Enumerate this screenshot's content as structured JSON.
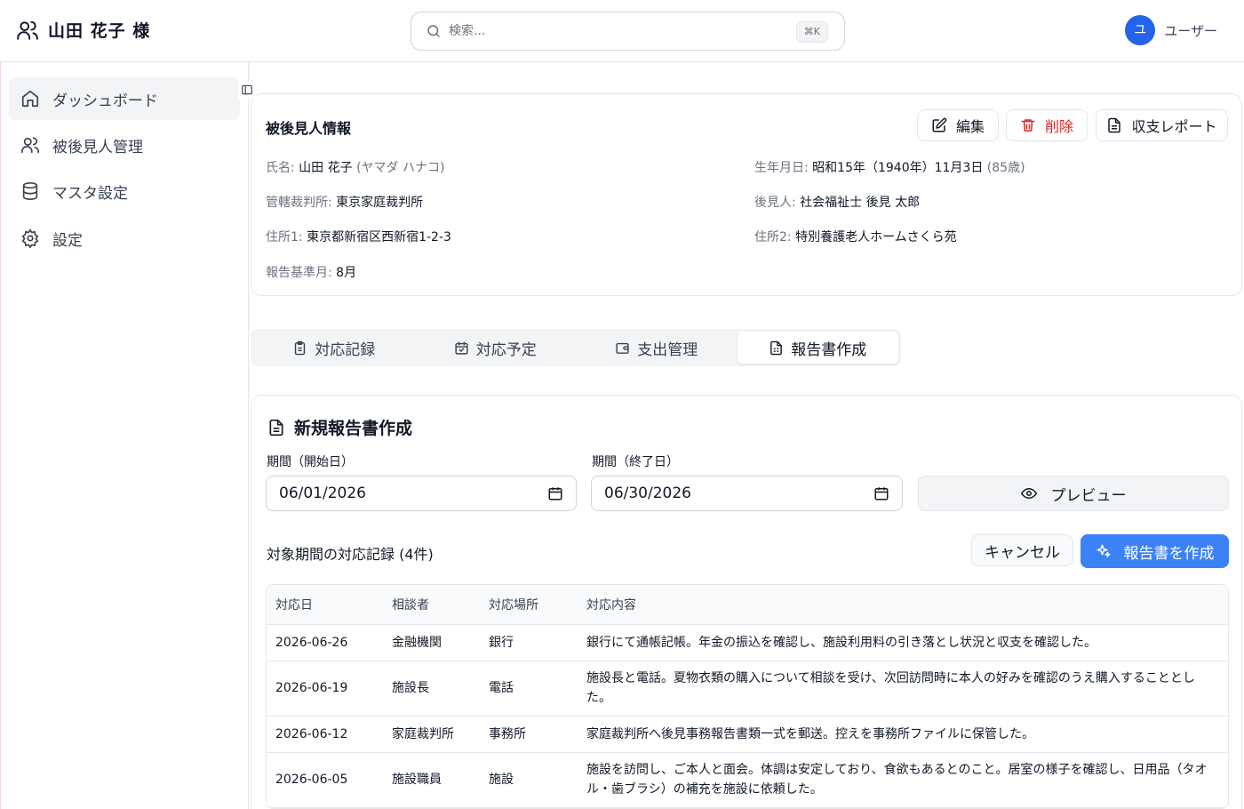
{
  "header": {
    "title": "山田 花子 様",
    "search_placeholder": "検索...",
    "shortcut": "⌘K",
    "user_initial": "ユ",
    "user_label": "ユーザー"
  },
  "sidebar": {
    "items": [
      {
        "label": "ダッシュボード",
        "icon": "home-icon"
      },
      {
        "label": "被後見人管理",
        "icon": "users-icon"
      },
      {
        "label": "マスタ設定",
        "icon": "database-icon"
      },
      {
        "label": "設定",
        "icon": "gear-icon"
      }
    ]
  },
  "info": {
    "title": "被後見人情報",
    "buttons": {
      "edit": "編集",
      "delete": "削除",
      "report": "収支レポート"
    },
    "name_label": "氏名:",
    "name_value": "山田 花子",
    "name_kana": "(ヤマダ ハナコ)",
    "birth_label": "生年月日:",
    "birth_value": "昭和15年（1940年）11月3日",
    "birth_age": "(85歳)",
    "court_label": "管轄裁判所:",
    "court_value": "東京家庭裁判所",
    "guardian_label": "後見人:",
    "guardian_value": "社会福祉士 後見 太郎",
    "address1_label": "住所1:",
    "address1_value": "東京都新宿区西新宿1-2-3",
    "address2_label": "住所2:",
    "address2_value": "特別養護老人ホームさくら苑",
    "report_month_label": "報告基準月:",
    "report_month_value": "8月"
  },
  "tabs": [
    {
      "label": "対応記録",
      "icon": "clipboard-icon"
    },
    {
      "label": "対応予定",
      "icon": "calendar-check-icon"
    },
    {
      "label": "支出管理",
      "icon": "wallet-icon"
    },
    {
      "label": "報告書作成",
      "icon": "document-icon"
    }
  ],
  "report": {
    "title": "新規報告書作成",
    "start_label": "期間（開始日）",
    "start_value": "06/01/2026",
    "end_label": "期間（終了日）",
    "end_value": "06/30/2026",
    "preview_label": "プレビュー",
    "records_title": "対象期間の対応記録 (4件)",
    "cancel_label": "キャンセル",
    "create_label": "報告書を作成",
    "columns": [
      "対応日",
      "相談者",
      "対応場所",
      "対応内容"
    ],
    "rows": [
      {
        "date": "2026-06-26",
        "person": "金融機関",
        "place": "銀行",
        "content": "銀行にて通帳記帳。年金の振込を確認し、施設利用料の引き落とし状況と収支を確認した。"
      },
      {
        "date": "2026-06-19",
        "person": "施設長",
        "place": "電話",
        "content": "施設長と電話。夏物衣類の購入について相談を受け、次回訪問時に本人の好みを確認のうえ購入することとした。"
      },
      {
        "date": "2026-06-12",
        "person": "家庭裁判所",
        "place": "事務所",
        "content": "家庭裁判所へ後見事務報告書類一式を郵送。控えを事務所ファイルに保管した。"
      },
      {
        "date": "2026-06-05",
        "person": "施設職員",
        "place": "施設",
        "content": "施設を訪問し、ご本人と面会。体調は安定しており、食欲もあるとのこと。居室の様子を確認し、日用品（タオル・歯ブラシ）の補充を施設に依頼した。"
      }
    ]
  }
}
